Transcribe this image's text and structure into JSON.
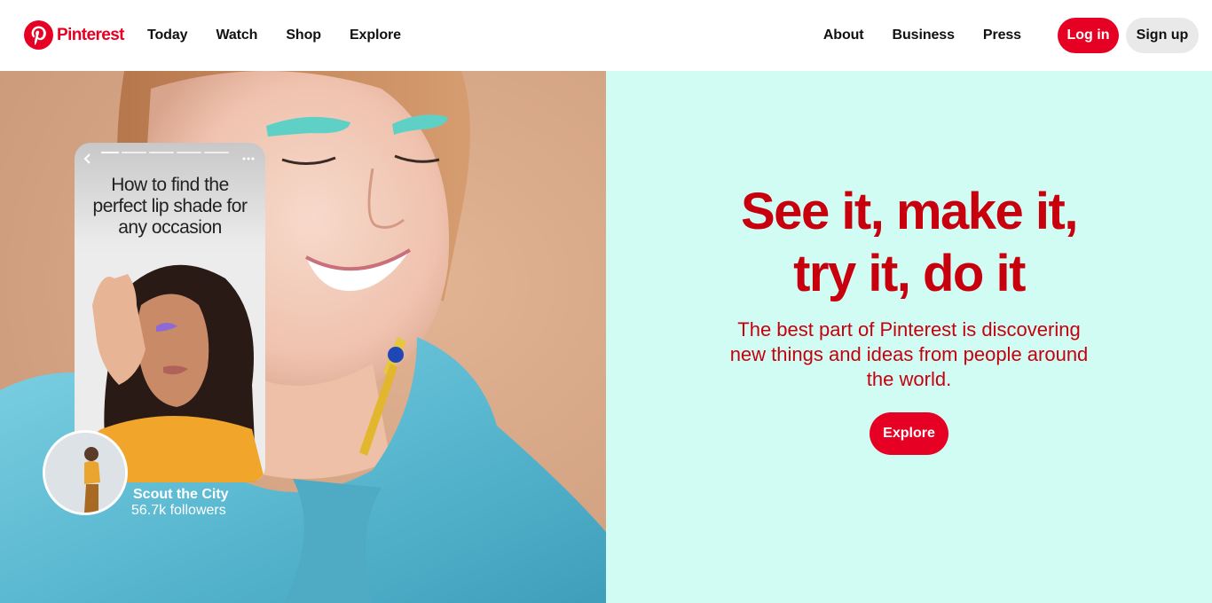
{
  "header": {
    "logo_text": "Pinterest",
    "nav_left": [
      "Today",
      "Watch",
      "Shop",
      "Explore"
    ],
    "nav_right": [
      "About",
      "Business",
      "Press"
    ],
    "login_label": "Log in",
    "signup_label": "Sign up"
  },
  "hero": {
    "headline_line1": "See it, make it,",
    "headline_line2": "try it, do it",
    "subtext": "The best part of Pinterest is discovering new things and ideas from people around the world.",
    "explore_label": "Explore"
  },
  "story_card": {
    "title": "How to find the perfect lip shade for any occasion",
    "creator_name": "Scout the City",
    "creator_followers": "56.7k followers"
  },
  "colors": {
    "brand_red": "#e60023",
    "headline_red": "#c8000e",
    "right_panel_bg": "#d0fcf4",
    "signup_bg": "#e9e9e9"
  }
}
